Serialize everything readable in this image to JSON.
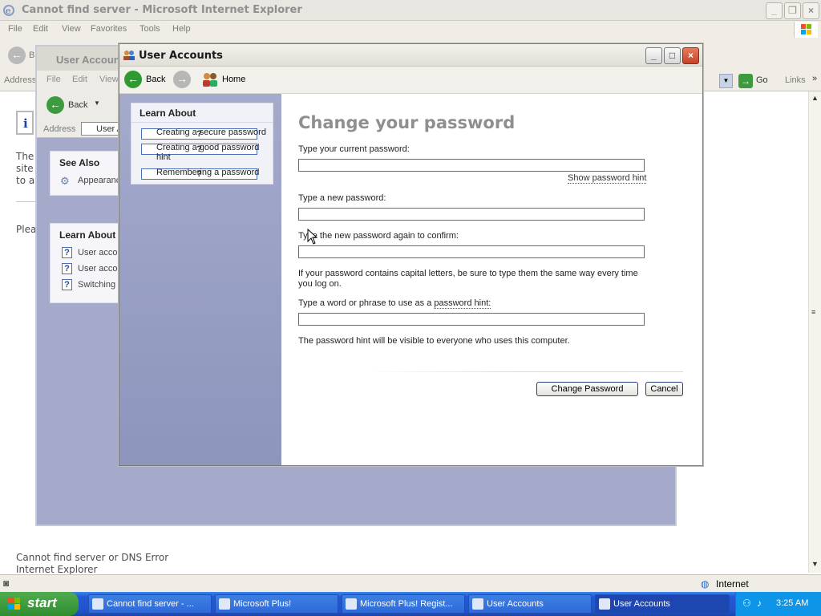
{
  "ie": {
    "title": "Cannot find server - Microsoft Internet Explorer",
    "menu": [
      "File",
      "Edit",
      "View",
      "Favorites",
      "Tools",
      "Help"
    ],
    "back_label": "B",
    "address_label": "Address",
    "go_label": "Go",
    "links_label": "Links",
    "page_lines": [
      "The",
      "site",
      "to a"
    ],
    "page_please": "Plea",
    "page_error": "Cannot find server or DNS Error",
    "page_ie": "Internet Explorer",
    "status_zone": "Internet"
  },
  "ua_back": {
    "title": "User Accoun",
    "menu": [
      "File",
      "Edit",
      "View"
    ],
    "back_label": "Back",
    "address_label": "Address",
    "address_value": "User A",
    "see_also": {
      "heading": "See Also",
      "items": [
        "Appearanc"
      ]
    },
    "learn_about": {
      "heading": "Learn About",
      "items": [
        "User accou",
        "User accou",
        "Switching u"
      ]
    }
  },
  "ua": {
    "title": "User Accounts",
    "nav": {
      "back": "Back",
      "home": "Home"
    },
    "learn_about": {
      "heading": "Learn About",
      "items": [
        "Creating a secure password",
        "Creating a good password hint",
        "Remembering a password"
      ]
    },
    "form": {
      "heading": "Change your password",
      "current_label": "Type your current password:",
      "current_value": "",
      "show_hint": "Show password hint",
      "new_label": "Type a new password:",
      "new_value": "",
      "confirm_label": "Type the new password again to confirm:",
      "confirm_value": "",
      "caps_note": "If your password contains capital letters, be sure to type them the same way every time you log on.",
      "hint_label_prefix": "Type a word or phrase to use as a ",
      "hint_link": "password hint:",
      "hint_value": "",
      "hint_note": "The password hint will be visible to everyone who uses this computer.",
      "change_button": "Change Password",
      "cancel_button": "Cancel"
    }
  },
  "taskbar": {
    "start": "start",
    "tasks": [
      "Cannot find server - ...",
      "Microsoft Plus!",
      "Microsoft Plus! Regist...",
      "User Accounts",
      "User Accounts"
    ],
    "active_task": 4,
    "clock": "3:25 AM"
  },
  "colors": {
    "taskbar_blue": "#2459d6",
    "start_green": "#2f8c2f",
    "sidebar": "#a4aacb",
    "heading_gray": "#8f8f8f"
  }
}
